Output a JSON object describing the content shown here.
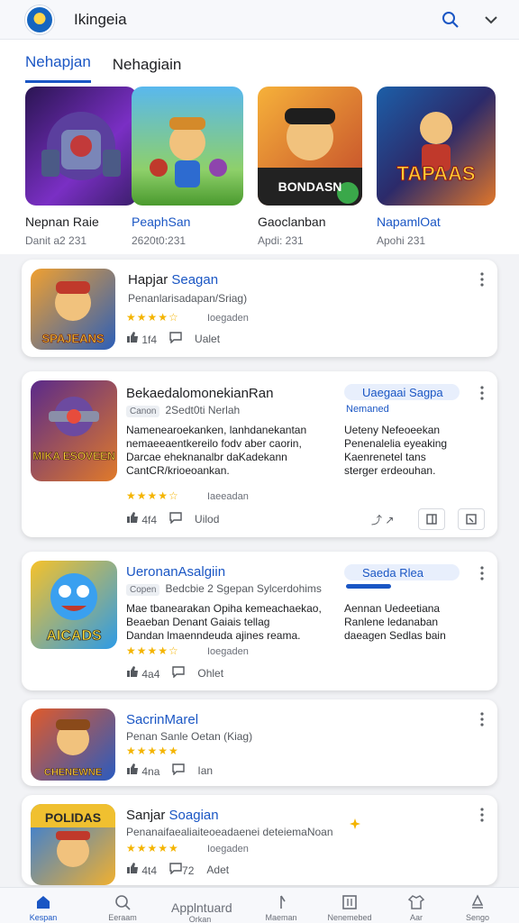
{
  "search": {
    "query": "Ikingeia"
  },
  "tabs": [
    {
      "label": "Nehapjan",
      "active": true
    },
    {
      "label": "Nehagiain",
      "active": false
    }
  ],
  "featured": [
    {
      "name": "Nepnan Raie",
      "meta": "Danit a2 231",
      "colors": [
        "#3b1e6b",
        "#8e3fd6"
      ]
    },
    {
      "name": "PeaphSan",
      "meta": "2620t0:231",
      "colors": [
        "#3aa0e0",
        "#5dbb3a"
      ]
    },
    {
      "name": "Gaoclanban",
      "meta": "Apdi: 231",
      "colors": [
        "#f2a33a",
        "#c2482a"
      ],
      "overlay": "BONDASN"
    },
    {
      "name": "NapamlOat",
      "meta": "Apohi 231",
      "colors": [
        "#1c5fa8",
        "#e0762a"
      ],
      "overlay": "TAPAAS"
    }
  ],
  "cards": [
    {
      "title": "Hapjar Seagan",
      "title_prefix": "Hapjar ",
      "title_suffix": "Seagan",
      "sub": "Penanlarisadapan/Sriag)",
      "stars": "★★★★☆",
      "rating_label": "Ioegaden",
      "likes": "1f4",
      "comments": "Ualet",
      "icon_text": "SPAJEANS",
      "icon_colors": [
        "#f0a030",
        "#2c5fb8"
      ]
    },
    {
      "title": "BekaedalomonekianRan",
      "tag": "Canon",
      "sub": "2Sedt0ti Nerlah",
      "desc": "Namenearoekanken, lanhdanekantan\nnemaeeaentkereilo fodv aber caorin,\nDarcae eheknanalbr daKadekann\nCantCR/krioeoankan.",
      "stars": "★★★★☆",
      "rating_label": "Iaeeadan",
      "likes": "4f4",
      "comments": "Uilod",
      "icon_text": "MIKA ESOVEEN",
      "icon_colors": [
        "#5a2a8a",
        "#e07a2a"
      ],
      "pill": "Uaegaai Sagpa",
      "pill_sub": "Nemaned",
      "side_desc": "Ueteny Nefeoeekan\nPenenalelia eyeaking\nKaenrenetel tans\nsterger erdeouhan.",
      "share": "⤴ ↗"
    },
    {
      "title": "UeronanAsalgiin",
      "tag": "Copen",
      "sub": "Bedcbie 2 Sgepan Sylcerdohims",
      "desc": "Mae tbanearakan Opiha kemeachaekao,\nBeaeban Denant Gaiais tellag\nDandan lmaenndeuda ajines reama.",
      "stars": "★★★★☆",
      "rating_label": "Ioegaden",
      "likes": "4a4",
      "comments": "Ohlet",
      "icon_text": "AICADS",
      "icon_colors": [
        "#f6c22a",
        "#2d9be6"
      ],
      "pill": "Saeda Rlea",
      "side_desc": "Aennan Uedeetiana\nRanlene ledanaban\ndaeagen Sedlas bain"
    },
    {
      "title": "SacrinMarel",
      "sub": "Penan Sanle Oetan (Kiag)",
      "stars": "★★★★★",
      "likes": "4na",
      "comments": "Ian",
      "icon_text": "CHENEWNE",
      "icon_colors": [
        "#e05a2a",
        "#2a5bc0"
      ]
    },
    {
      "title": "Sanjar Soagian",
      "title_prefix": "Sanjar ",
      "title_suffix": "Soagian",
      "sub": "Penanaifaealiaiteoeadaenei deteiemaNoan",
      "stars": "★★★★★",
      "rating_label": "Ioegaden",
      "likes": "4t4",
      "comments": "Adet",
      "comment_count": "72",
      "icon_text": "POLIDAS",
      "icon_colors": [
        "#2c7be0",
        "#f0b030"
      ]
    }
  ],
  "bottom_nav": {
    "center": "Applntuard",
    "items": [
      {
        "label": "Kespan",
        "icon": "home-icon"
      },
      {
        "label": "Eeraam",
        "icon": "search-icon"
      },
      {
        "label": "Orkan",
        "icon": "apps-icon"
      },
      {
        "label": "Maeman",
        "icon": "bell-icon"
      },
      {
        "label": "Nenemebed",
        "icon": "news-icon"
      },
      {
        "label": "Aar",
        "icon": "shirt-icon"
      },
      {
        "label": "Sengo",
        "icon": "profile-icon"
      }
    ]
  },
  "colors": {
    "accent": "#1a56c4",
    "star": "#f4b400"
  }
}
